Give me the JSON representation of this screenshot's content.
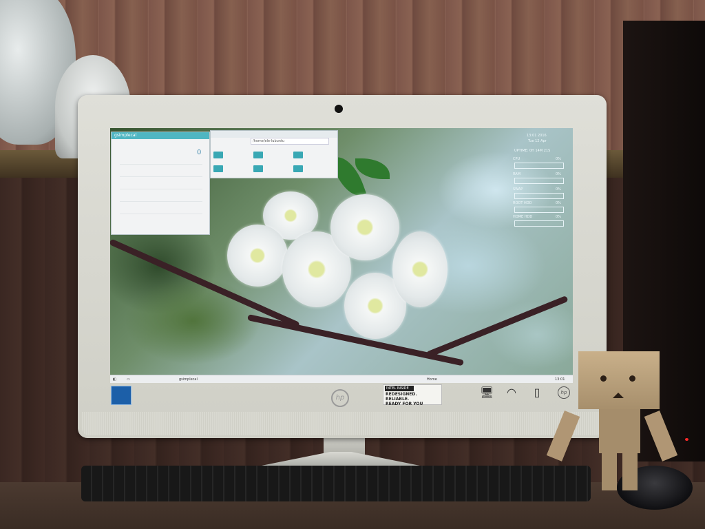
{
  "scene": {
    "description_type": "photo of desktop all-in-one computer"
  },
  "monitor": {
    "brand_logo": "hp",
    "sticker_header": "INTEL INSIDE",
    "sticker_text_line1": "REDESIGNED. RELIABLE.",
    "sticker_text_line2": "READY FOR YOU"
  },
  "screen": {
    "calendar_window": {
      "title": "gsimplecal",
      "day_number": "0"
    },
    "file_manager_window": {
      "path": "/home/ele-lubuntu"
    },
    "conky": {
      "time_line": "13:01 2016",
      "date_line": "Tue 12 Apr",
      "uptime": "UPTIME: 0H 14M 21S",
      "rows": [
        {
          "label": "CPU",
          "value": "0%"
        },
        {
          "label": "RAM",
          "value": "0%"
        },
        {
          "label": "SWAP",
          "value": "0%"
        },
        {
          "label": "ROOT HDD",
          "value": "0%"
        },
        {
          "label": "HOME HDD",
          "value": "0%"
        }
      ]
    },
    "taskbar": {
      "items": [
        "gsimplecal",
        "Home"
      ],
      "clock": "13:01"
    }
  }
}
